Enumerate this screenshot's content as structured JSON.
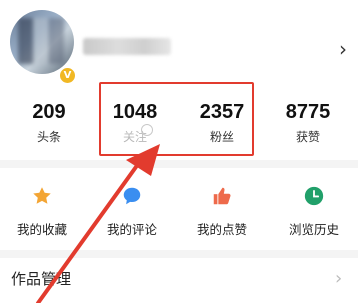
{
  "profile": {
    "verified_badge": "V",
    "more_chevron": "›"
  },
  "stats": [
    {
      "value": "209",
      "label": "头条"
    },
    {
      "value": "1048",
      "label": "关注"
    },
    {
      "value": "2357",
      "label": "粉丝"
    },
    {
      "value": "8775",
      "label": "获赞"
    }
  ],
  "actions": [
    {
      "label": "我的收藏",
      "icon": "star-icon",
      "color": "#f3a534"
    },
    {
      "label": "我的评论",
      "icon": "comment-icon",
      "color": "#3a8ef0"
    },
    {
      "label": "我的点赞",
      "icon": "thumbs-up-icon",
      "color": "#ee6a4b"
    },
    {
      "label": "浏览历史",
      "icon": "clock-icon",
      "color": "#21a06a"
    }
  ],
  "works": {
    "title": "作品管理",
    "chevron": "›"
  },
  "annotation": {
    "box_color": "#e23b2e",
    "arrow_color": "#e23b2e"
  }
}
